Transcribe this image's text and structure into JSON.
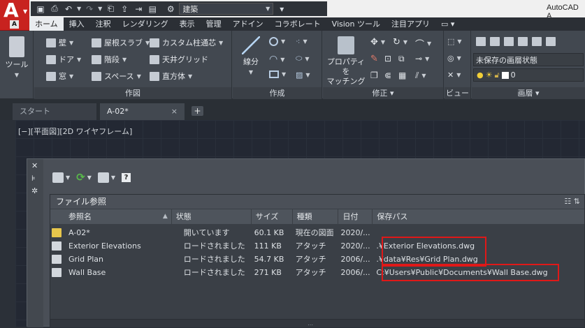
{
  "app": {
    "title": "AutoCAD A",
    "logo_letter": "A",
    "logo_small": "A"
  },
  "qat": {
    "workspace": "建築"
  },
  "ribbon_tabs": [
    "ホーム",
    "挿入",
    "注釈",
    "レンダリング",
    "表示",
    "管理",
    "アドイン",
    "コラボレート",
    "Vision ツール",
    "注目アプリ",
    "▭ ▾"
  ],
  "ribbon": {
    "tool_label": "ツール",
    "build": {
      "wall": "壁",
      "door": "ドア",
      "window": "窓",
      "roof_slab": "屋根スラブ",
      "stair": "階段",
      "space": "スペース",
      "custom_column": "カスタム柱通芯",
      "ceiling_grid": "天井グリッド",
      "cuboid": "直方体",
      "panel_title": "作図"
    },
    "draw": {
      "line": "線分",
      "panel_title": "作成"
    },
    "modify": {
      "properties_match_1": "プロパティを",
      "properties_match_2": "マッチング",
      "panel_title": "修正 ▾"
    },
    "view": {
      "panel_title": "ビュー"
    },
    "layers": {
      "state": "未保存の画層状態",
      "layer": "0",
      "panel_title": "画層 ▾"
    }
  },
  "doc_tabs": {
    "start": "スタート",
    "active": "A-02*",
    "close": "×",
    "add": "+"
  },
  "viewport_label": "[−][平面図][2D ワイヤフレーム]",
  "palette": {
    "side": {
      "close": "✕",
      "pin": "⊧",
      "settings": "✲"
    },
    "help": "?",
    "section_title": "ファイル参照",
    "columns": [
      "参照名",
      "状態",
      "サイズ",
      "種類",
      "日付",
      "保存パス"
    ],
    "rows": [
      {
        "name": "A-02*",
        "status": "開いています",
        "size": "60.1 KB",
        "type": "現在の図面",
        "date": "2020/...",
        "path": ""
      },
      {
        "name": "Exterior Elevations",
        "status": "ロードされました",
        "size": "111 KB",
        "type": "アタッチ",
        "date": "2020/...",
        "path": ".¥Exterior Elevations.dwg"
      },
      {
        "name": "Grid Plan",
        "status": "ロードされました",
        "size": "54.7 KB",
        "type": "アタッチ",
        "date": "2006/...",
        "path": ".¥data¥Res¥Grid Plan.dwg"
      },
      {
        "name": "Wall Base",
        "status": "ロードされました",
        "size": "271 KB",
        "type": "アタッチ",
        "date": "2006/...",
        "path": "C:¥Users¥Public¥Documents¥Wall Base.dwg"
      }
    ]
  }
}
